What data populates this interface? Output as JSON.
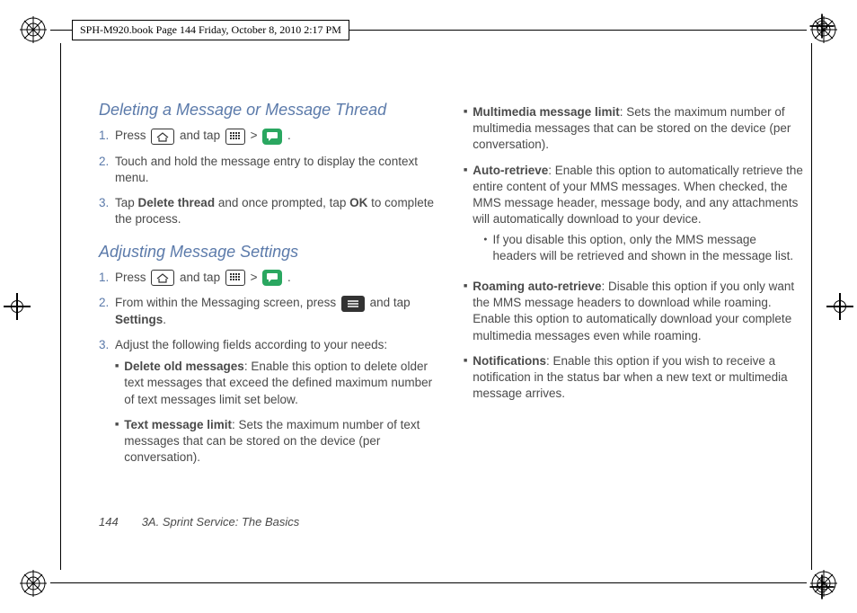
{
  "header": {
    "text": "SPH-M920.book  Page 144  Friday, October 8, 2010  2:17 PM"
  },
  "left": {
    "h1": "Deleting a Message or Message Thread",
    "step1_a": "Press ",
    "step1_b": " and tap ",
    "step1_c": "  >  ",
    "step1_d": " .",
    "step2": "Touch and hold the message entry to display the context menu.",
    "step3_a": "Tap ",
    "step3_bold1": "Delete thread",
    "step3_b": " and once prompted, tap ",
    "step3_bold2": "OK",
    "step3_c": " to complete the process.",
    "h2": "Adjusting Message Settings",
    "a_step1_a": "Press ",
    "a_step1_b": " and tap ",
    "a_step1_c": "  >  ",
    "a_step1_d": " .",
    "a_step2_a": "From within the Messaging screen, press ",
    "a_step2_b": " and tap ",
    "a_step2_bold": "Settings",
    "a_step2_c": ".",
    "a_step3": "Adjust the following fields according to your needs:",
    "b1_bold": "Delete old messages",
    "b1_rest": ": Enable this option to delete older text messages that exceed the defined maximum number of text messages limit set below.",
    "b2_bold": "Text message limit",
    "b2_rest": ": Sets the maximum number of text messages that can be stored on the device (per conversation)."
  },
  "right": {
    "b3_bold": "Multimedia message limit",
    "b3_rest": ": Sets the maximum number of multimedia messages that can be stored on the device (per conversation).",
    "b4_bold": "Auto-retrieve",
    "b4_rest": ": Enable this option to automatically retrieve the entire content of your MMS messages. When checked, the MMS message header, message body, and any attachments will automatically download to your device.",
    "b4_sub": "If you disable this option, only the MMS message headers will be retrieved and shown in the message list.",
    "b5_bold": "Roaming auto-retrieve",
    "b5_rest": ": Disable this option if you only want the MMS message headers to download while roaming. Enable this option to automatically download your complete multimedia messages even while roaming.",
    "b6_bold": "Notifications",
    "b6_rest": ": Enable this option if you wish to receive a notification in the status bar when a new text or multimedia message arrives."
  },
  "footer": {
    "page": "144",
    "title": "3A. Sprint Service: The Basics"
  },
  "nums": {
    "n1": "1.",
    "n2": "2.",
    "n3": "3."
  }
}
